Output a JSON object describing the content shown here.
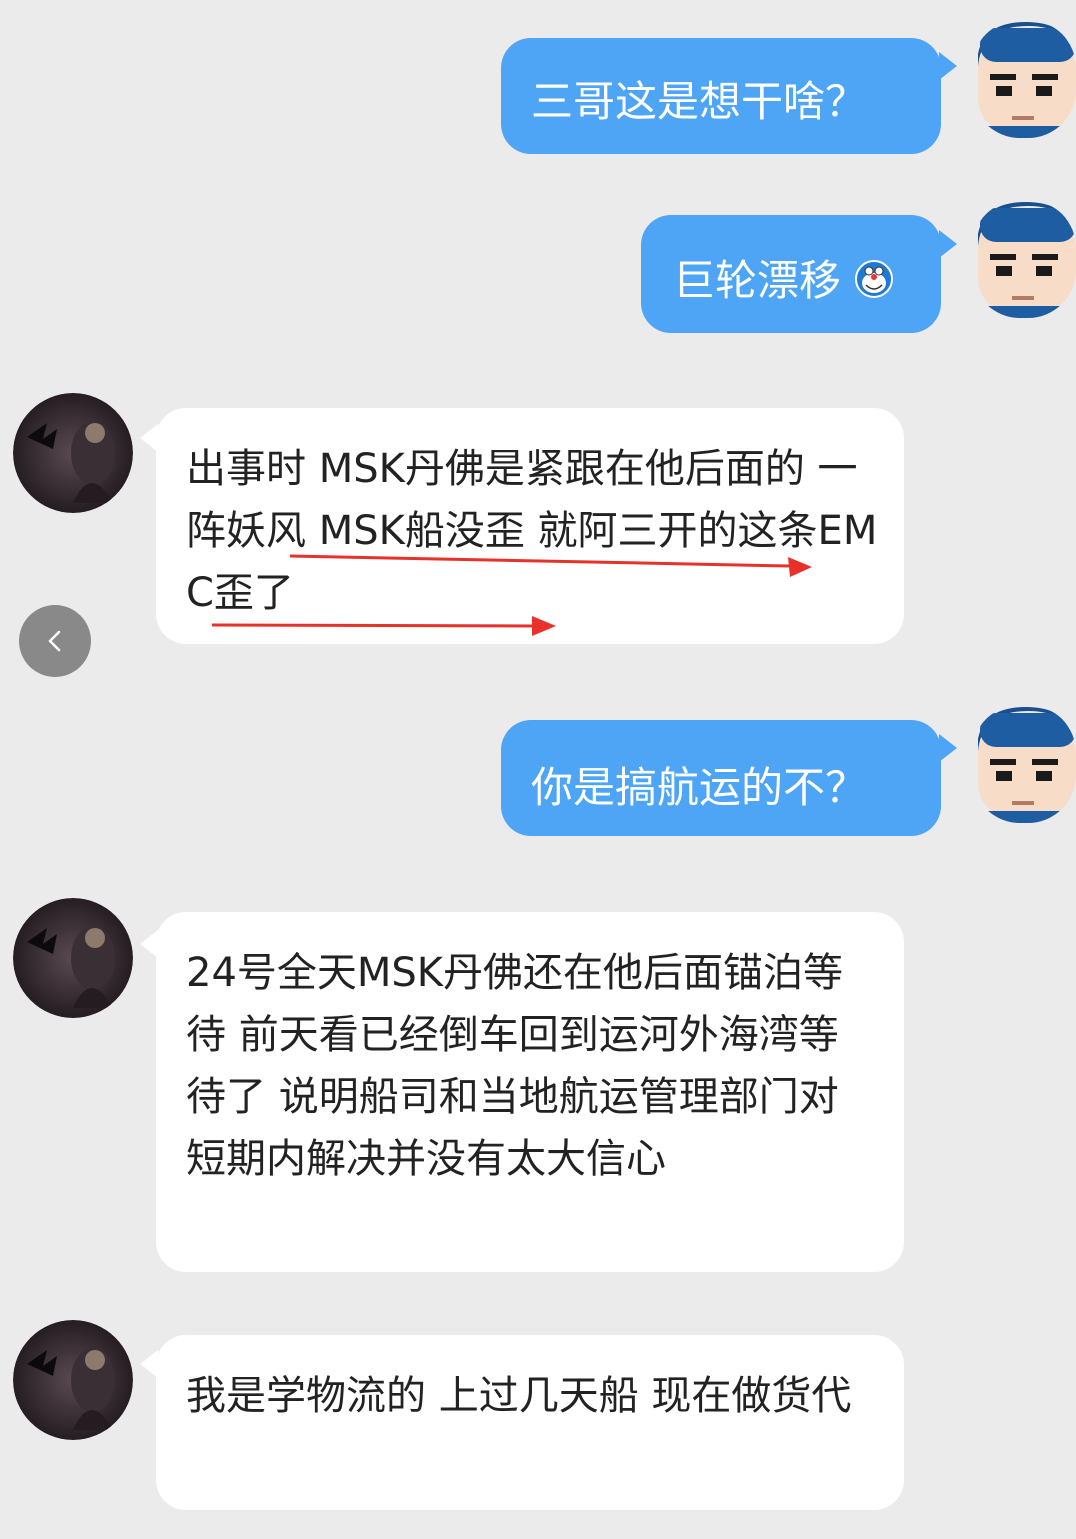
{
  "messages": [
    {
      "side": "sent",
      "text": "三哥这是想干啥？"
    },
    {
      "side": "sent",
      "text": "巨轮漂移",
      "emoji": "doraemon-emoji"
    },
    {
      "side": "received",
      "text": "出事时 MSK丹佛是紧跟在他后面的 一阵妖风 MSK船没歪 就阿三开的这条EMC歪了"
    },
    {
      "side": "sent",
      "text": "你是搞航运的不？"
    },
    {
      "side": "received",
      "text": "24号全天MSK丹佛还在他后面锚泊等待 前天看已经倒车回到运河外海湾等待了 说明船司和当地航运管理部门对短期内解决并没有太大信心"
    },
    {
      "side": "received",
      "text": "我是学物流的 上过几天船 现在做货代"
    }
  ],
  "icons": {
    "back": "chevron-left-icon",
    "sender_avatar": "cartoon-face-avatar",
    "receiver_avatar": "dark-fantasy-avatar",
    "annotation": "red-arrow-icon"
  },
  "colors": {
    "background": "#ebebeb",
    "sent_bubble": "#4ea5f5",
    "received_bubble": "#ffffff",
    "annotation_arrow": "#e8312a"
  }
}
